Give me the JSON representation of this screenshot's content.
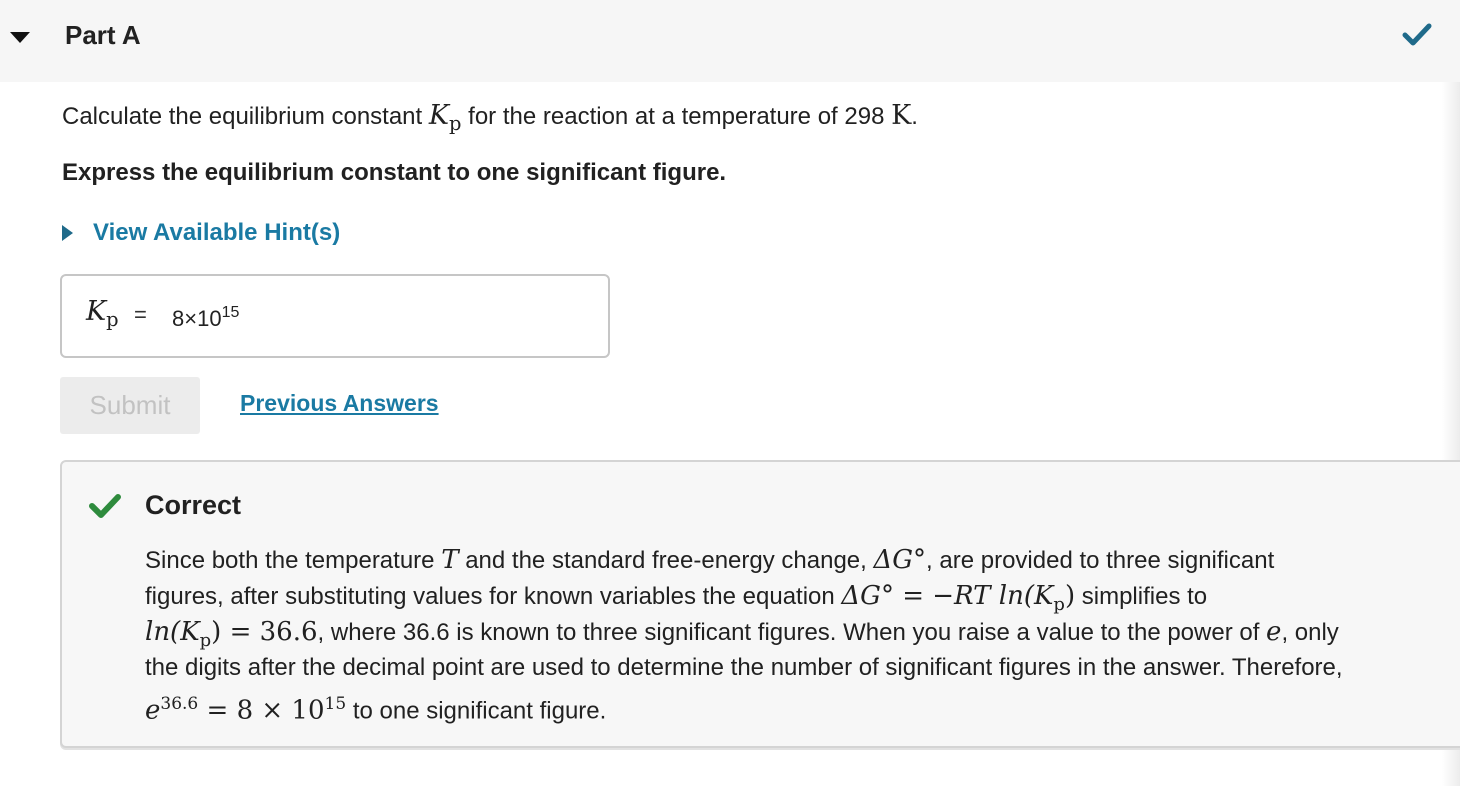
{
  "part": {
    "title": "Part A"
  },
  "question": {
    "prefix": "Calculate the equilibrium constant ",
    "var": "K",
    "var_sub": "p",
    "suffix_a": " for the reaction at a temperature of 298 ",
    "unit": "K",
    "suffix_b": "."
  },
  "instruction": "Express the equilibrium constant to one significant figure.",
  "hint": {
    "label": "View Available Hint(s)"
  },
  "answer": {
    "label": "K",
    "label_sub": "p",
    "equals": "=",
    "mantissa": "8×10",
    "exponent": "15"
  },
  "submit_label": "Submit",
  "previous_answers_label": "Previous Answers",
  "feedback": {
    "title": "Correct",
    "line1_a": "Since both the temperature ",
    "line1_T": "T",
    "line1_b": " and the standard free-energy change, ",
    "line1_dG": "ΔG°",
    "line1_c": ", are provided to three significant",
    "line2_a": "figures, after substituting values for known variables the equation ",
    "line2_eq": "ΔG° = −RT ln(K",
    "line2_eq_sub": "p",
    "line2_eq_end": ")",
    "line2_b": " simplifies to",
    "line3_eq": "ln(K",
    "line3_eq_sub": "p",
    "line3_eq_end": ") = 36.6",
    "line3_b": ", where 36.6 is known to three significant figures. When you raise a value to the power of ",
    "line3_e": "e",
    "line3_c": ", only",
    "line4": "the digits after the decimal point are used to determine the number of significant figures in the answer. Therefore,",
    "line5_e": "e",
    "line5_exp": "36.6",
    "line5_eq": " = 8 × 10",
    "line5_eq_exp": "15",
    "line5_b": " to one significant figure."
  },
  "colors": {
    "link": "#1a7aa3",
    "correct_green": "#2e8b3d",
    "status_check": "#1f6a8a"
  }
}
